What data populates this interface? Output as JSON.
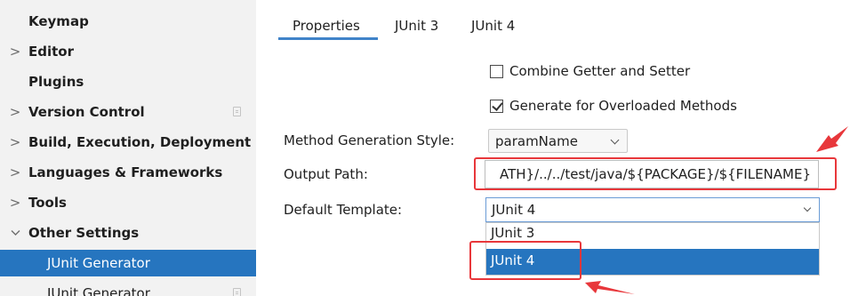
{
  "sidebar": {
    "items": [
      {
        "label": "Keymap",
        "chevron": ""
      },
      {
        "label": "Editor",
        "chevron": ">"
      },
      {
        "label": "Plugins",
        "chevron": ""
      },
      {
        "label": "Version Control",
        "chevron": ">"
      },
      {
        "label": "Build, Execution, Deployment",
        "chevron": ">"
      },
      {
        "label": "Languages & Frameworks",
        "chevron": ">"
      },
      {
        "label": "Tools",
        "chevron": ">"
      },
      {
        "label": "Other Settings",
        "chevron": "v"
      },
      {
        "label": "JUnit Generator",
        "chevron": ""
      },
      {
        "label": "JUnit Generator",
        "chevron": ""
      }
    ]
  },
  "tabs": [
    "Properties",
    "JUnit 3",
    "JUnit 4"
  ],
  "options": {
    "combine": {
      "label": "Combine Getter and Setter",
      "checked": false
    },
    "overloaded": {
      "label": "Generate for Overloaded Methods",
      "checked": true
    }
  },
  "form": {
    "method_style_label": "Method Generation Style:",
    "method_style_value": "paramName",
    "output_path_label": "Output Path:",
    "output_path_value": "ATH}/../../test/java/${PACKAGE}/${FILENAME}",
    "default_template_label": "Default Template:",
    "default_template_value": "JUnit 4",
    "template_options": [
      "JUnit 3",
      "JUnit 4"
    ]
  },
  "colors": {
    "accent": "#2675bf",
    "annotation": "#e8373b"
  }
}
